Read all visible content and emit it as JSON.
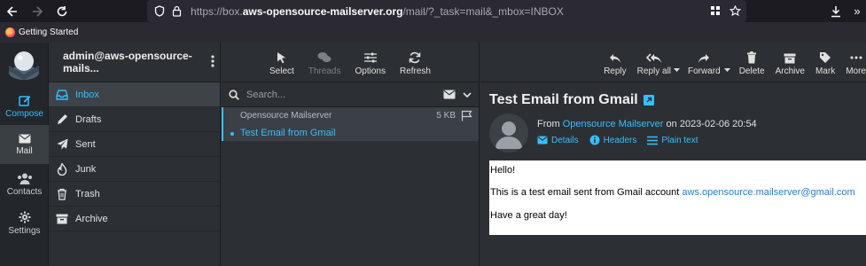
{
  "browser": {
    "url_prefix": "https://box.",
    "url_domain": "aws-opensource-mailserver.org",
    "url_suffix": "/mail/?_task=mail&_mbox=INBOX",
    "bookmark_label": "Getting Started"
  },
  "account": {
    "name": "admin@aws-opensource-mails..."
  },
  "rail": {
    "compose": "Compose",
    "mail": "Mail",
    "contacts": "Contacts",
    "settings": "Settings"
  },
  "folders": [
    {
      "label": "Inbox",
      "icon": "inbox-icon"
    },
    {
      "label": "Drafts",
      "icon": "pencil-icon"
    },
    {
      "label": "Sent",
      "icon": "paper-plane-icon"
    },
    {
      "label": "Junk",
      "icon": "fire-icon"
    },
    {
      "label": "Trash",
      "icon": "trash-icon"
    },
    {
      "label": "Archive",
      "icon": "archive-icon"
    }
  ],
  "list_toolbar": {
    "select": "Select",
    "threads": "Threads",
    "options": "Options",
    "refresh": "Refresh"
  },
  "search": {
    "placeholder": "Search..."
  },
  "messages": [
    {
      "from": "Opensource Mailserver",
      "size": "5 KB",
      "subject": "Test Email from Gmail"
    }
  ],
  "reader_toolbar": {
    "reply": "Reply",
    "reply_all": "Reply all",
    "forward": "Forward",
    "delete": "Delete",
    "archive": "Archive",
    "mark": "Mark",
    "more": "More"
  },
  "message": {
    "subject": "Test Email from Gmail",
    "from_prefix": "From",
    "sender": "Opensource Mailserver",
    "date_prefix": "on",
    "date": "2023-02-06 20:54",
    "details": "Details",
    "headers": "Headers",
    "plain_text": "Plain text",
    "greeting": "Hello!",
    "line_prefix": "This is a test email sent from Gmail account",
    "email": "aws.opensource.mailserver@gmail.com",
    "closing": "Have a great day!"
  },
  "colors": {
    "accent": "#37beff",
    "bg": "#2c3034",
    "rail": "#23272b"
  }
}
